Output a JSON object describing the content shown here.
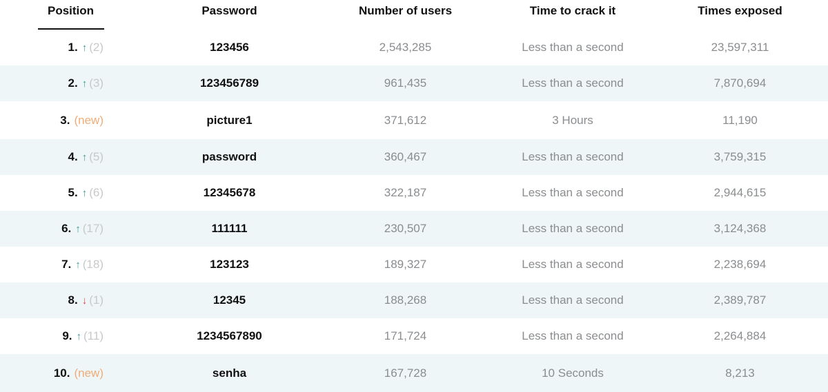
{
  "headers": {
    "position": "Position",
    "password": "Password",
    "users": "Number of users",
    "time": "Time to crack it",
    "exposed": "Times exposed"
  },
  "colors": {
    "up": "#3d9a94",
    "down": "#e0454e",
    "new": "#f0ac78",
    "row_tint": "#eef6f7"
  },
  "rows": [
    {
      "rank": "1.",
      "trend": "up",
      "arrow": "↑",
      "prev": "(2)",
      "password": "123456",
      "users": "2,543,285",
      "time": "Less than a second",
      "exposed": "23,597,311"
    },
    {
      "rank": "2.",
      "trend": "up",
      "arrow": "↑",
      "prev": "(3)",
      "password": "123456789",
      "users": "961,435",
      "time": "Less than a second",
      "exposed": "7,870,694"
    },
    {
      "rank": "3.",
      "trend": "new",
      "arrow": "",
      "prev": "(new)",
      "password": "picture1",
      "users": "371,612",
      "time": "3 Hours",
      "exposed": "11,190"
    },
    {
      "rank": "4.",
      "trend": "up",
      "arrow": "↑",
      "prev": "(5)",
      "password": "password",
      "users": "360,467",
      "time": "Less than a second",
      "exposed": "3,759,315"
    },
    {
      "rank": "5.",
      "trend": "up",
      "arrow": "↑",
      "prev": "(6)",
      "password": "12345678",
      "users": "322,187",
      "time": "Less than a second",
      "exposed": "2,944,615"
    },
    {
      "rank": "6.",
      "trend": "up",
      "arrow": "↑",
      "prev": "(17)",
      "password": "111111",
      "users": "230,507",
      "time": "Less than a second",
      "exposed": "3,124,368"
    },
    {
      "rank": "7.",
      "trend": "up",
      "arrow": "↑",
      "prev": "(18)",
      "password": "123123",
      "users": "189,327",
      "time": "Less than a second",
      "exposed": "2,238,694"
    },
    {
      "rank": "8.",
      "trend": "down",
      "arrow": "↓",
      "prev": "(1)",
      "password": "12345",
      "users": "188,268",
      "time": "Less than a second",
      "exposed": "2,389,787"
    },
    {
      "rank": "9.",
      "trend": "up",
      "arrow": "↑",
      "prev": "(11)",
      "password": "1234567890",
      "users": "171,724",
      "time": "Less than a second",
      "exposed": "2,264,884"
    },
    {
      "rank": "10.",
      "trend": "new",
      "arrow": "",
      "prev": "(new)",
      "password": "senha",
      "users": "167,728",
      "time": "10 Seconds",
      "exposed": "8,213"
    }
  ]
}
